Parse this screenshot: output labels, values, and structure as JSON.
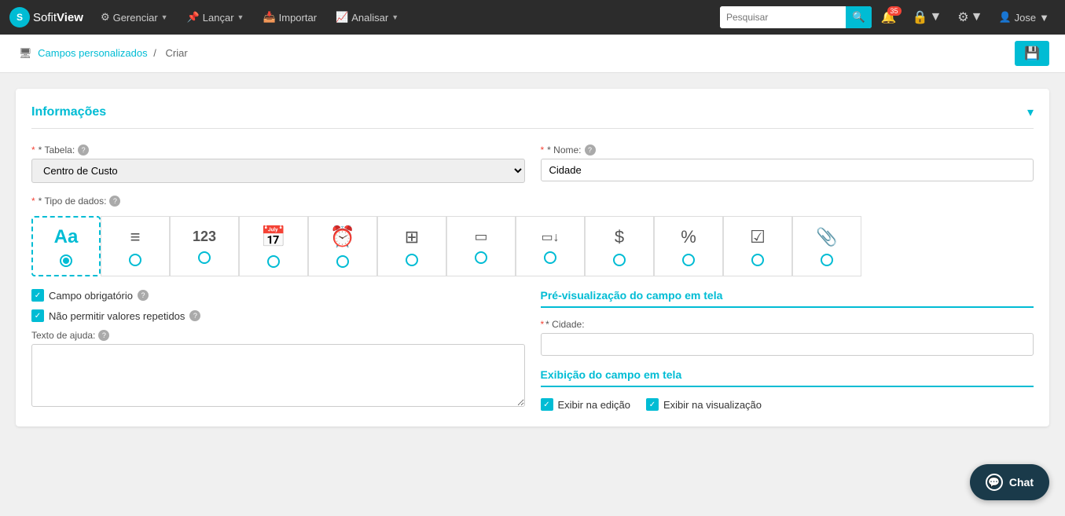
{
  "brand": {
    "logo_text": "S",
    "name_light": "Sofit",
    "name_bold": "View"
  },
  "navbar": {
    "items": [
      {
        "id": "gerenciar",
        "label": "Gerenciar",
        "has_arrow": true,
        "icon": "⚙"
      },
      {
        "id": "lancar",
        "label": "Lançar",
        "has_arrow": true,
        "icon": "📌"
      },
      {
        "id": "importar",
        "label": "Importar",
        "has_arrow": false,
        "icon": "📥"
      },
      {
        "id": "analisar",
        "label": "Analisar",
        "has_arrow": true,
        "icon": "📈"
      }
    ],
    "search_placeholder": "Pesquisar",
    "notification_count": "35",
    "user_name": "Jose"
  },
  "breadcrumb": {
    "parent_label": "Campos personalizados",
    "separator": "/",
    "current": "Criar"
  },
  "section": {
    "title": "Informações"
  },
  "form": {
    "tabela_label": "* Tabela:",
    "tabela_value": "Centro de Custo",
    "nome_label": "* Nome:",
    "nome_value": "Cidade",
    "tipo_label": "* Tipo de dados:",
    "tipo_help": "?",
    "data_types": [
      {
        "id": "text",
        "symbol": "Aa",
        "selected": true
      },
      {
        "id": "multiline",
        "symbol": "≡",
        "selected": false
      },
      {
        "id": "number",
        "symbol": "123",
        "selected": false
      },
      {
        "id": "date",
        "symbol": "📅",
        "selected": false
      },
      {
        "id": "datetime",
        "symbol": "🕐",
        "selected": false
      },
      {
        "id": "grid",
        "symbol": "⊞",
        "selected": false
      },
      {
        "id": "input1",
        "symbol": "▭",
        "selected": false
      },
      {
        "id": "input2",
        "symbol": "▭↓",
        "selected": false
      },
      {
        "id": "currency",
        "symbol": "$",
        "selected": false
      },
      {
        "id": "percent",
        "symbol": "%",
        "selected": false
      },
      {
        "id": "checkbox_type",
        "symbol": "☑",
        "selected": false
      },
      {
        "id": "attachment",
        "symbol": "📎",
        "selected": false
      }
    ],
    "required_label": "Campo obrigatório",
    "required_checked": true,
    "no_repeat_label": "Não permitir valores repetidos",
    "no_repeat_checked": true,
    "help_text_label": "Texto de ajuda:",
    "help_text_value": ""
  },
  "preview": {
    "title": "Pré-visualização do campo em tela",
    "field_label": "* Cidade:",
    "field_placeholder": ""
  },
  "display": {
    "title": "Exibição do campo em tela",
    "show_edit_label": "Exibir na edição",
    "show_edit_checked": true,
    "show_view_label": "Exibir na visualização",
    "show_view_checked": true
  },
  "chat": {
    "label": "Chat"
  }
}
